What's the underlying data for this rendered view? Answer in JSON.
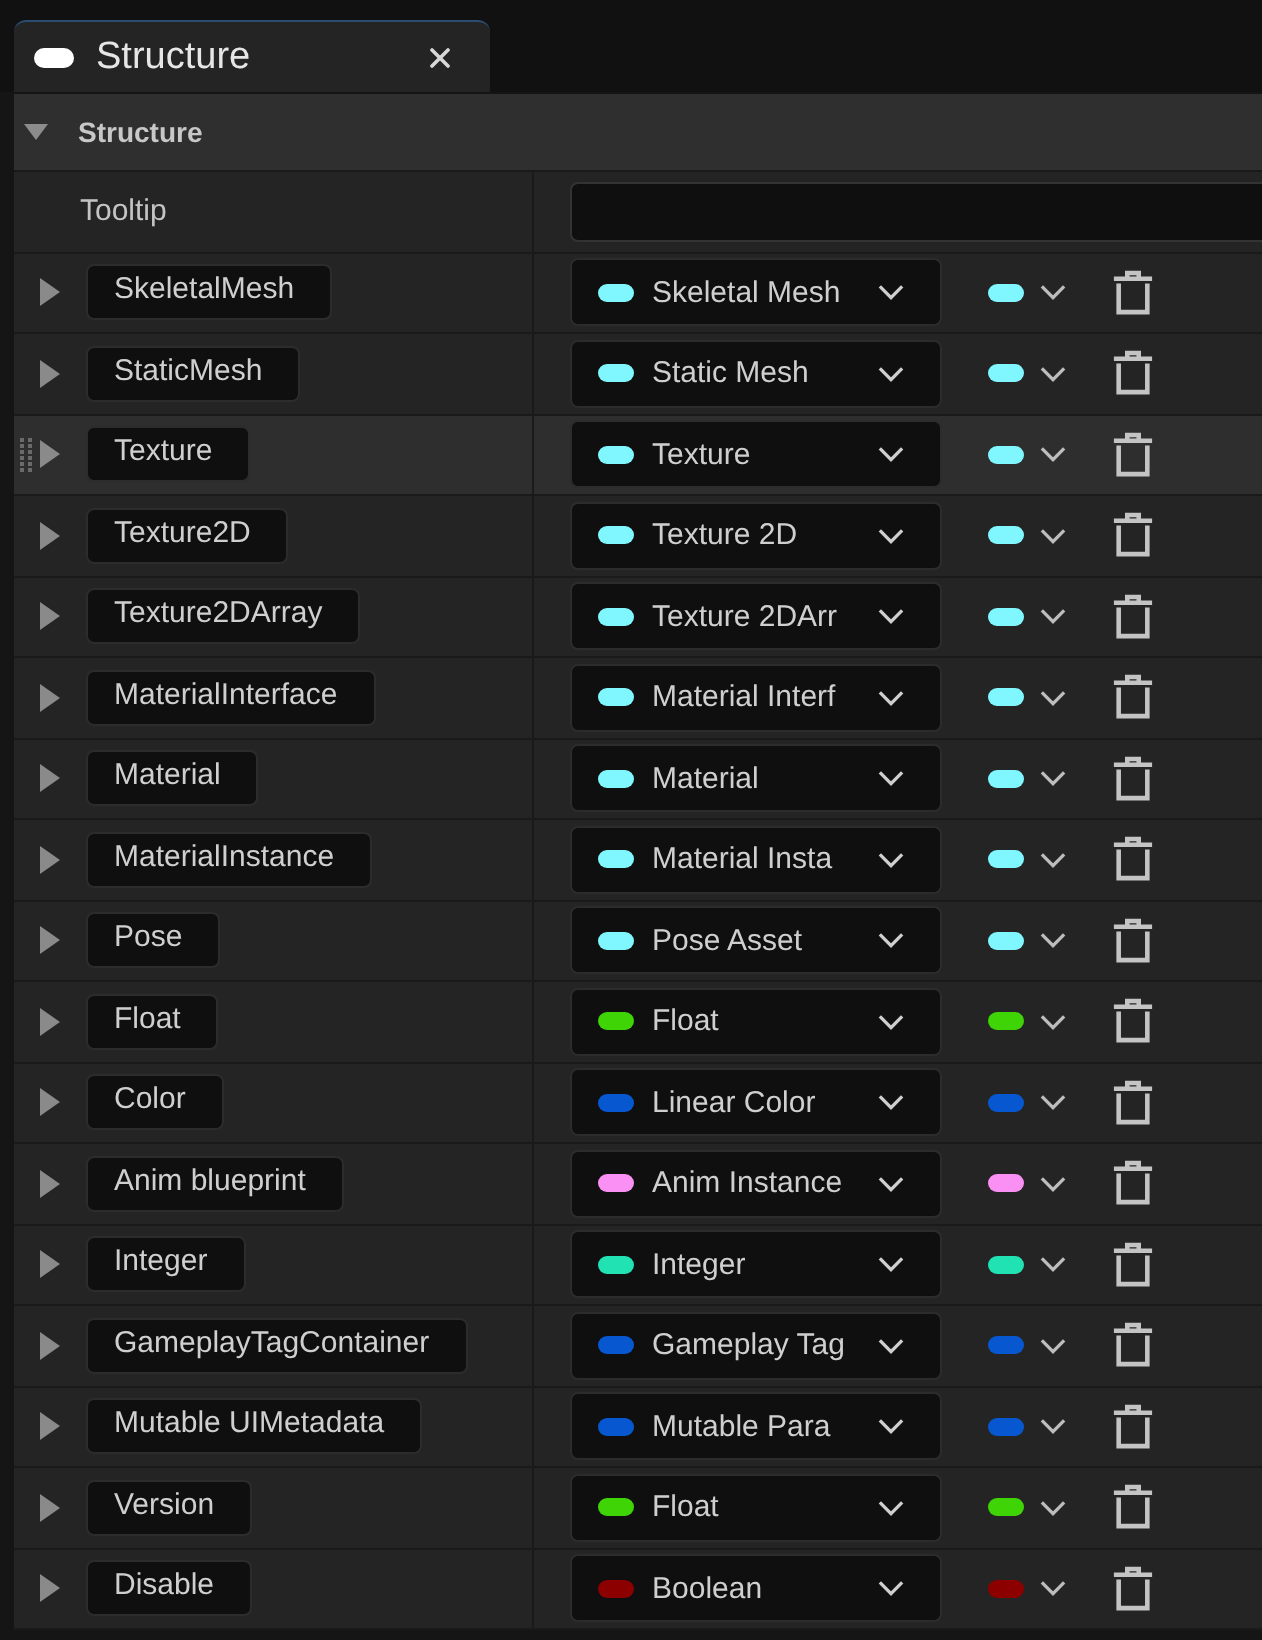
{
  "tab": {
    "title": "Structure",
    "selected": true
  },
  "section": {
    "title": "Structure",
    "expanded": true
  },
  "tooltip": {
    "label": "Tooltip"
  },
  "members": [
    {
      "name": "SkeletalMesh",
      "type": "Skeletal Mesh",
      "color": "#80f7ff",
      "expanded": false,
      "hovered": false
    },
    {
      "name": "StaticMesh",
      "type": "Static Mesh",
      "color": "#80f7ff",
      "expanded": false,
      "hovered": false
    },
    {
      "name": "Texture",
      "type": "Texture",
      "color": "#80f7ff",
      "expanded": false,
      "hovered": true
    },
    {
      "name": "Texture2D",
      "type": "Texture 2D",
      "color": "#80f7ff",
      "expanded": false,
      "hovered": false
    },
    {
      "name": "Texture2DArray",
      "type": "Texture 2DArr",
      "color": "#80f7ff",
      "expanded": false,
      "hovered": false
    },
    {
      "name": "MaterialInterface",
      "type": "Material Interf",
      "color": "#80f7ff",
      "expanded": false,
      "hovered": false
    },
    {
      "name": "Material",
      "type": "Material",
      "color": "#80f7ff",
      "expanded": false,
      "hovered": false
    },
    {
      "name": "MaterialInstance",
      "type": "Material Insta",
      "color": "#80f7ff",
      "expanded": false,
      "hovered": false
    },
    {
      "name": "Pose",
      "type": "Pose Asset",
      "color": "#80f7ff",
      "expanded": false,
      "hovered": false
    },
    {
      "name": "Float",
      "type": "Float",
      "color": "#3ed406",
      "expanded": false,
      "hovered": false
    },
    {
      "name": "Color",
      "type": "Linear Color",
      "color": "#0758d0",
      "expanded": false,
      "hovered": false
    },
    {
      "name": "Anim blueprint",
      "type": "Anim Instance",
      "color": "#fb90f4",
      "expanded": false,
      "hovered": false
    },
    {
      "name": "Integer",
      "type": "Integer",
      "color": "#20e2b2",
      "expanded": false,
      "hovered": false
    },
    {
      "name": "GameplayTagContainer",
      "type": "Gameplay Tag",
      "color": "#0758d0",
      "expanded": false,
      "hovered": false
    },
    {
      "name": "Mutable UIMetadata",
      "type": "Mutable Para",
      "color": "#0758d0",
      "expanded": false,
      "hovered": false
    },
    {
      "name": "Version",
      "type": "Float",
      "color": "#3ed406",
      "expanded": false,
      "hovered": false
    },
    {
      "name": "Disable",
      "type": "Boolean",
      "color": "#8c0000",
      "expanded": false,
      "hovered": false
    }
  ]
}
